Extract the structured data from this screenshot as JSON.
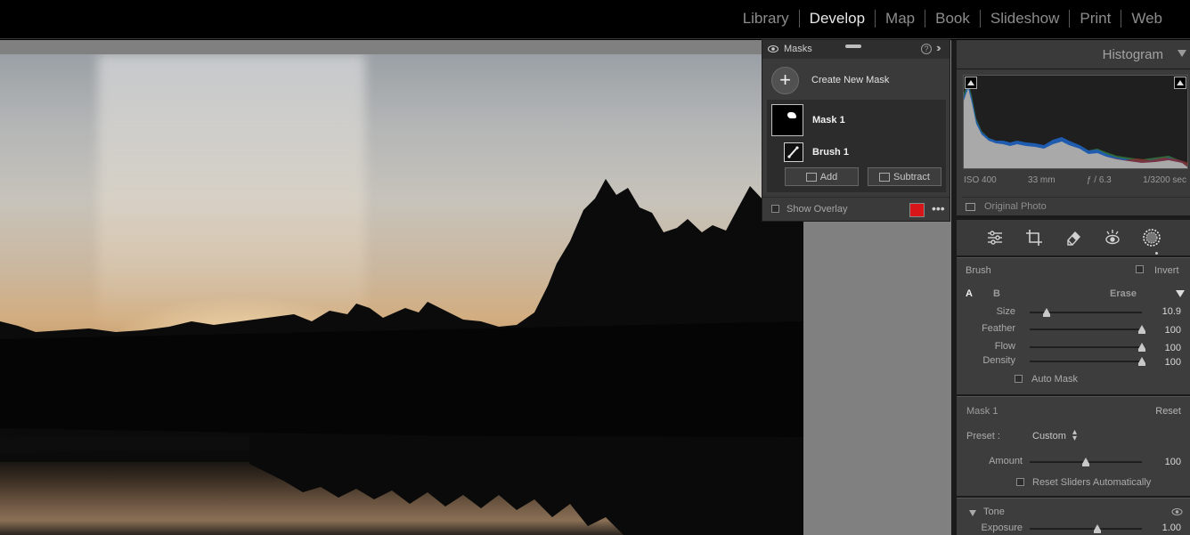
{
  "topbar": {
    "modules": [
      {
        "label": "Library",
        "active": false
      },
      {
        "label": "Develop",
        "active": true
      },
      {
        "label": "Map",
        "active": false
      },
      {
        "label": "Book",
        "active": false
      },
      {
        "label": "Slideshow",
        "active": false
      },
      {
        "label": "Print",
        "active": false
      },
      {
        "label": "Web",
        "active": false
      }
    ]
  },
  "masks": {
    "title": "Masks",
    "create_label": "Create New Mask",
    "mask_name": "Mask 1",
    "brush_name": "Brush 1",
    "add_label": "Add",
    "subtract_label": "Subtract",
    "show_overlay_label": "Show Overlay",
    "overlay_color": "#d8161a"
  },
  "histogram": {
    "title": "Histogram",
    "iso": "ISO 400",
    "focal": "33 mm",
    "aperture": "ƒ / 6.3",
    "shutter": "1/3200 sec",
    "original_photo_label": "Original Photo"
  },
  "tools": [
    "edit-sliders-icon",
    "crop-icon",
    "heal-eraser-icon",
    "redeye-icon",
    "mask-icon"
  ],
  "brush": {
    "title": "Brush",
    "invert_label": "Invert",
    "tab_a": "A",
    "tab_b": "B",
    "erase_label": "Erase",
    "sliders": [
      {
        "label": "Size",
        "value": "10.9",
        "fraction": 0.15
      },
      {
        "label": "Feather",
        "value": "100",
        "fraction": 1.0
      },
      {
        "label": "Flow",
        "value": "100",
        "fraction": 1.0
      },
      {
        "label": "Density",
        "value": "100",
        "fraction": 1.0
      }
    ],
    "auto_mask_label": "Auto Mask"
  },
  "mask_settings": {
    "title": "Mask 1",
    "reset_label": "Reset",
    "preset_label": "Preset :",
    "preset_value": "Custom",
    "amount_label": "Amount",
    "amount_value": "100",
    "amount_fraction": 0.5,
    "reset_sliders_label": "Reset Sliders Automatically"
  },
  "tone": {
    "title": "Tone",
    "exposure_label": "Exposure",
    "exposure_value": "1.00",
    "exposure_fraction": 0.6
  }
}
